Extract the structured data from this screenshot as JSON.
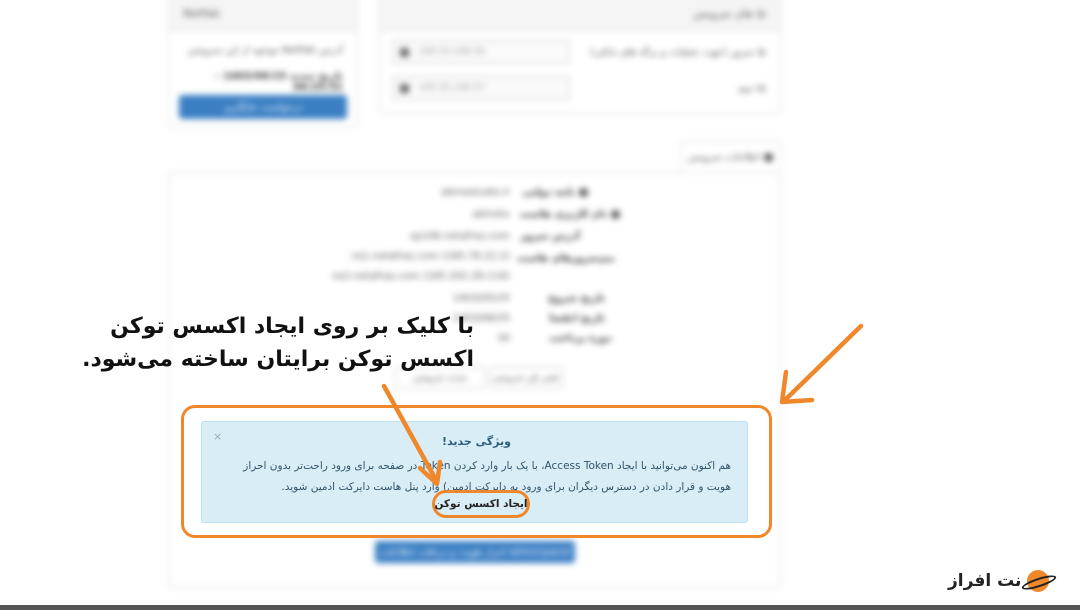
{
  "blur": {
    "top_right_panel_title": "ip های سرویس",
    "row1_label": "ip سرور (جهت عملیات و برگه های بانکی)",
    "row1_value": "185.55.168.56",
    "row2_label": "ip دوم",
    "row2_value": "185.55.168.57",
    "top_left_panel_title": "Netfab",
    "top_left_line1": "آدرس Netfab موجود از این سرویس",
    "top_left_line2": "تاریخ تمدید 1403/06/15 - 06:25:31",
    "top_left_button": "درخواست جایگزین",
    "info_tab": "اطلاعات سرویس",
    "info_rows": [
      {
        "label": "نامه دولتی",
        "value": "abmastudio.ir"
      },
      {
        "label": "نام کاربری هاست",
        "value": "abmstu"
      },
      {
        "label": "آدرس سرور",
        "value": "sp106.netafraz.com"
      },
      {
        "label": "نیم‌سرورهای هاست",
        "value": "ns1.netafraz.com (185.78.22.2)"
      },
      {
        "label": "",
        "value": "ns2.netafraz.com (185.202.28.116)"
      },
      {
        "label": "تاریخ شروع",
        "value": "1403/05/25"
      },
      {
        "label": "تاریخ انقضا",
        "value": "1403/08/25"
      },
      {
        "label": "دوره پرداخت",
        "value": "30"
      }
    ],
    "btn_change": "تغییر پلن سرویس",
    "btn_renew": "تمدید سرویس",
    "bottom_button": "احراز هویت و دریافت اطلاعات whm/cpanel"
  },
  "alert": {
    "title": "ویژگی جدید!",
    "close": "×",
    "body": "هم اکنون می‌توانید با ایجاد Access Token، با یک بار وارد کردن Token در صفحه برای ورود راحت‌تر بدون احراز هویت و قرار دادن در دسترس دیگران برای ورود به دایرکت ادمین) وارد پنل هاست دایرکت ادمین شوید.",
    "link": "ایجاد اکسس توکن"
  },
  "annotation": {
    "line1": "با کلیک بر روی ایجاد اکسس توکن",
    "line2": "اکسس توکن برایتان ساخته می‌شود."
  },
  "logo": {
    "text": "نت افراز"
  },
  "colors": {
    "accent": "#f0872a",
    "alert_bg": "#d9edf7",
    "button_blue": "#3a7fc4"
  }
}
